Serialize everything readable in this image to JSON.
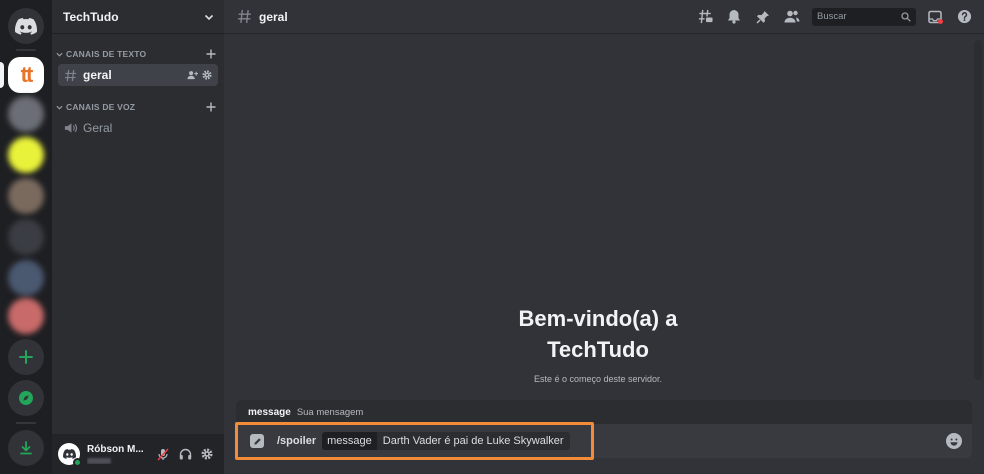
{
  "server": {
    "name": "TechTudo",
    "icon_letters": "tt",
    "categories": [
      {
        "label": "CANAIS DE TEXTO",
        "channels": [
          {
            "label": "geral"
          }
        ]
      },
      {
        "label": "CANAIS DE VOZ",
        "channels": [
          {
            "label": "Geral"
          }
        ]
      }
    ]
  },
  "user": {
    "name": "Róbson M..."
  },
  "channel": {
    "title": "geral"
  },
  "search": {
    "placeholder": "Buscar"
  },
  "welcome": {
    "title": "Bem-vindo(a) a TechTudo",
    "subtitle": "Este é o começo deste servidor."
  },
  "option_hint": {
    "name": "message",
    "description": "Sua mensagem"
  },
  "composer": {
    "command": "/spoiler",
    "option_key": "message",
    "option_value": "Darth Vader é pai de Luke Skywalker"
  },
  "colors": {
    "accent_green": "#23a55a",
    "highlight_border": "#f28c38",
    "brand_orange": "#e8742a"
  }
}
